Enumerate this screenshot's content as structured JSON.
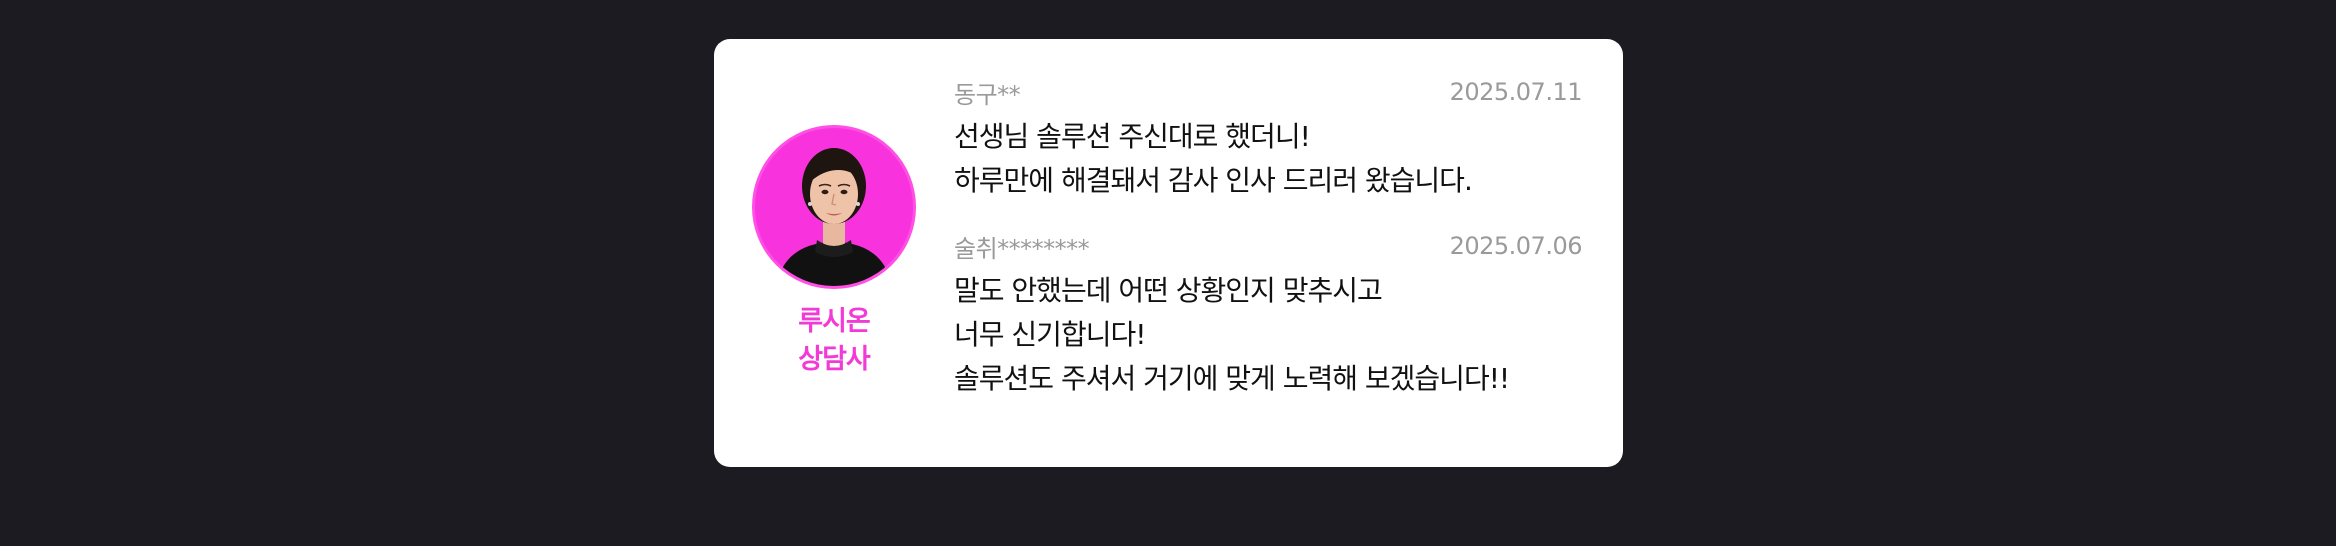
{
  "counselor": {
    "name_line1": "루시온",
    "name_line2": "상담사",
    "accent_color": "#F23AD6",
    "avatar_icon": "woman-portrait"
  },
  "reviews": [
    {
      "author": "동구**",
      "date": "2025.07.11",
      "lines": [
        "선생님 솔루션 주신대로 했더니!",
        "하루만에 해결돼서 감사 인사 드리러 왔습니다."
      ]
    },
    {
      "author": "술취********",
      "date": "2025.07.06",
      "lines": [
        "말도 안했는데 어떤 상황인지 맞추시고",
        "너무 신기합니다!",
        "솔루션도 주셔서 거기에 맞게 노력해 보겠습니다!!"
      ]
    }
  ]
}
